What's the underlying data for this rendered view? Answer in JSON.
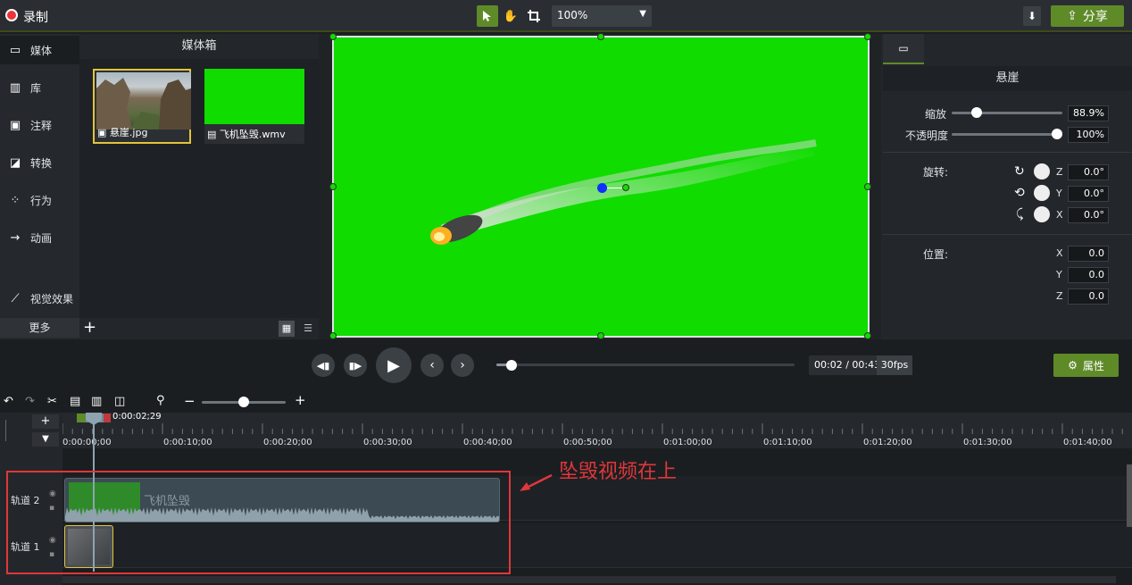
{
  "topbar": {
    "record_label": "录制",
    "zoom_value": "100%",
    "share_label": "分享"
  },
  "sidebar": {
    "items": [
      {
        "label": "媒体",
        "icon": "film-icon"
      },
      {
        "label": "库",
        "icon": "library-icon"
      },
      {
        "label": "注释",
        "icon": "annotation-icon"
      },
      {
        "label": "转换",
        "icon": "transition-icon"
      },
      {
        "label": "行为",
        "icon": "behavior-icon"
      },
      {
        "label": "动画",
        "icon": "animation-icon"
      },
      {
        "label": "视觉效果",
        "icon": "magic-wand-icon"
      }
    ],
    "more_label": "更多"
  },
  "media_bin": {
    "title": "媒体箱",
    "items": [
      {
        "name": "悬崖.jpg",
        "type": "image"
      },
      {
        "name": "飞机坠毁.wmv",
        "type": "video"
      }
    ]
  },
  "properties": {
    "title": "悬崖",
    "scale_label": "缩放",
    "scale_value": "88.9%",
    "scale_level": 0.2,
    "opacity_label": "不透明度",
    "opacity_value": "100%",
    "opacity_level": 1.0,
    "rotation_label": "旋转:",
    "rotation": [
      {
        "axis": "Z",
        "value": "0.0°"
      },
      {
        "axis": "Y",
        "value": "0.0°"
      },
      {
        "axis": "X",
        "value": "0.0°"
      }
    ],
    "position_label": "位置:",
    "position": [
      {
        "axis": "X",
        "value": "0.0"
      },
      {
        "axis": "Y",
        "value": "0.0"
      },
      {
        "axis": "Z",
        "value": "0.0"
      }
    ]
  },
  "playback": {
    "time": "00:02 / 00:43",
    "fps": "30fps",
    "progress": 0.05,
    "attr_label": "属性"
  },
  "timeline": {
    "playhead_time": "0:00:02;29",
    "ticks": [
      "0:00:00;00",
      "0:00:10;00",
      "0:00:20;00",
      "0:00:30;00",
      "0:00:40;00",
      "0:00:50;00",
      "0:01:00;00",
      "0:01:10;00",
      "0:01:20;00",
      "0:01:30;00",
      "0:01:40;00"
    ],
    "tracks": [
      {
        "name": "轨道 2",
        "clip": "飞机坠毁"
      },
      {
        "name": "轨道 1",
        "clip": ""
      }
    ]
  },
  "annotation": {
    "text": "坠毁视频在上",
    "color": "#e0373a"
  },
  "colors": {
    "accent": "#5f8a28",
    "canvas_green": "#10dc00"
  }
}
